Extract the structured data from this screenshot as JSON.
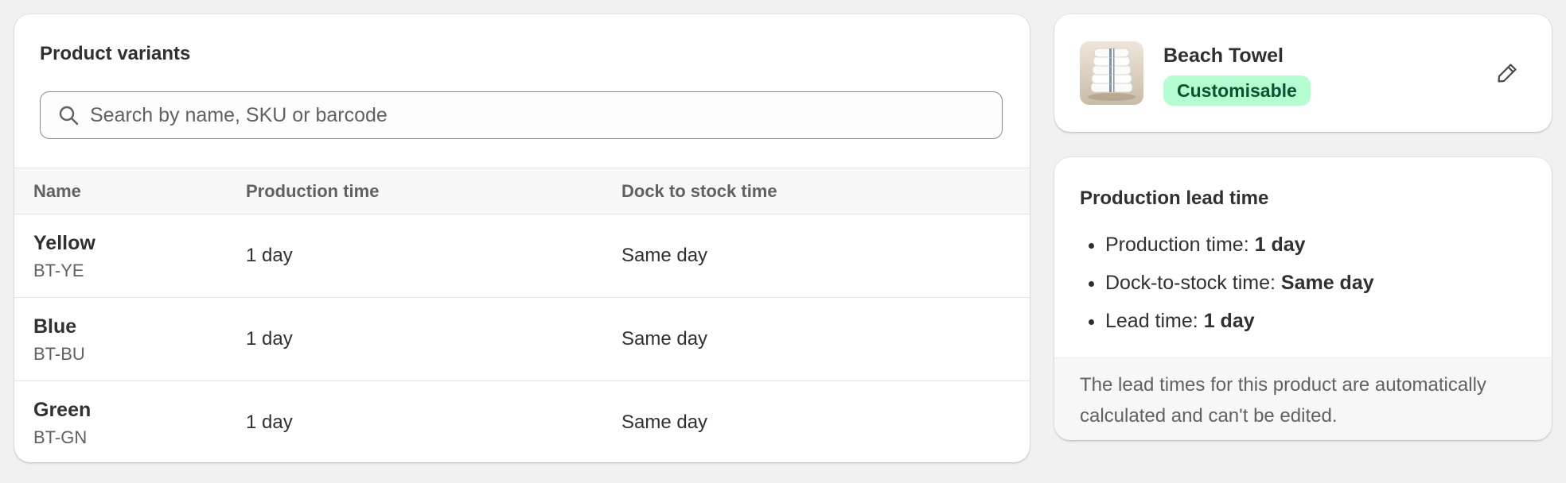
{
  "variants_card": {
    "title": "Product variants",
    "search": {
      "placeholder": "Search by name, SKU or barcode",
      "value": ""
    },
    "columns": [
      "Name",
      "Production time",
      "Dock to stock time"
    ],
    "rows": [
      {
        "name": "Yellow",
        "sku": "BT-YE",
        "production_time": "1 day",
        "dock_to_stock_time": "Same day"
      },
      {
        "name": "Blue",
        "sku": "BT-BU",
        "production_time": "1 day",
        "dock_to_stock_time": "Same day"
      },
      {
        "name": "Green",
        "sku": "BT-GN",
        "production_time": "1 day",
        "dock_to_stock_time": "Same day"
      }
    ]
  },
  "product_card": {
    "name": "Beach Towel",
    "badge": "Customisable",
    "badge_bg": "#b4fed2",
    "badge_fg": "#0c5132",
    "thumbnail_icon": "folded-towels-image",
    "edit_icon": "pencil-icon"
  },
  "lead_card": {
    "title": "Production lead time",
    "items": [
      {
        "label": "Production time:",
        "value": "1 day"
      },
      {
        "label": "Dock-to-stock time:",
        "value": "Same day"
      },
      {
        "label": "Lead time:",
        "value": "1 day"
      }
    ],
    "footer": "The lead times for this product are automatically calculated and can't be edited."
  }
}
